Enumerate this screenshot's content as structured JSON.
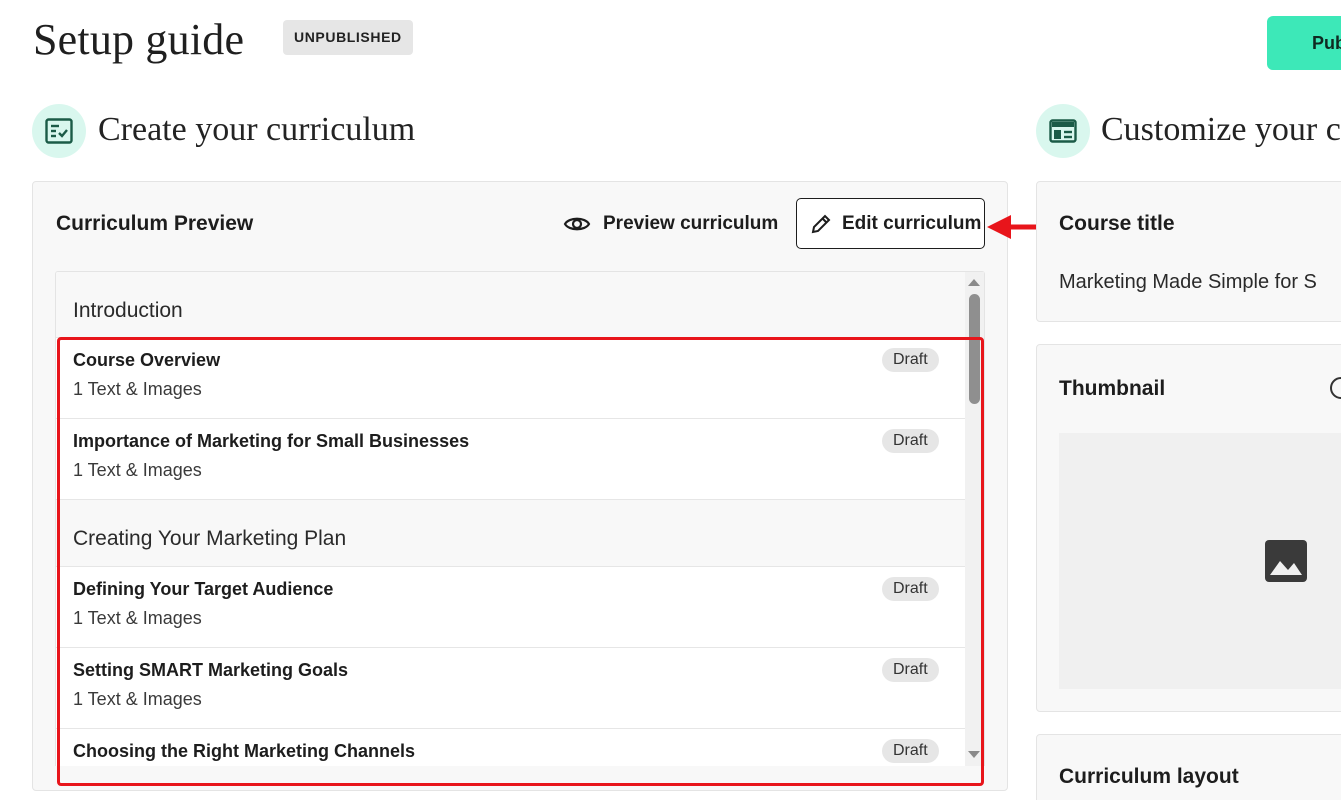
{
  "header": {
    "title": "Setup guide",
    "status_badge": "UNPUBLISHED",
    "publish_label": "Pub"
  },
  "curriculum_section": {
    "heading": "Create your curriculum",
    "icon": "checklist-icon",
    "card_title": "Curriculum Preview",
    "preview_label": "Preview curriculum",
    "edit_label": "Edit curriculum",
    "sections": [
      {
        "title": "Introduction",
        "lessons": [
          {
            "title": "Course Overview",
            "meta": "1 Text & Images",
            "status": "Draft"
          },
          {
            "title": "Importance of Marketing for Small Businesses",
            "meta": "1 Text & Images",
            "status": "Draft"
          }
        ]
      },
      {
        "title": "Creating Your Marketing Plan",
        "lessons": [
          {
            "title": "Defining Your Target Audience",
            "meta": "1 Text & Images",
            "status": "Draft"
          },
          {
            "title": "Setting SMART Marketing Goals",
            "meta": "1 Text & Images",
            "status": "Draft"
          },
          {
            "title": "Choosing the Right Marketing Channels",
            "meta": "",
            "status": "Draft"
          }
        ]
      }
    ]
  },
  "customize_section": {
    "heading": "Customize your c",
    "icon": "layout-icon",
    "course_title_label": "Course title",
    "course_title_value": "Marketing Made Simple for S",
    "thumbnail_label": "Thumbnail",
    "curriculum_layout_label": "Curriculum layout"
  },
  "colors": {
    "accent": "#3de8b8",
    "icon_bg": "#d9f7ee",
    "highlight": "#e8151b"
  }
}
